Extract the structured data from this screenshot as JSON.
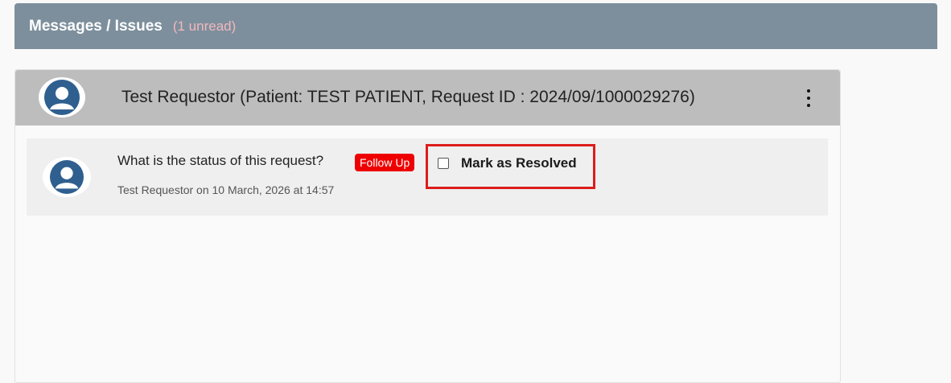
{
  "header": {
    "title": "Messages / Issues",
    "unread": "(1 unread)"
  },
  "thread": {
    "title": "Test Requestor (Patient: TEST PATIENT, Request ID : 2024/09/1000029276)",
    "avatar_icon": "user-avatar-icon",
    "menu_icon": "kebab-menu-icon"
  },
  "message": {
    "text": "What is the status of this request?",
    "badge": "Follow Up",
    "meta": "Test Requestor on 10 March, 2026 at 14:57",
    "resolve_label": "Mark as Resolved",
    "resolved": false,
    "avatar_icon": "user-avatar-icon"
  },
  "colors": {
    "header_bg": "#7d8f9d",
    "unread_text": "#f3b7bd",
    "thread_header_bg": "#bdbdbd",
    "avatar_blue": "#2f5f8f",
    "badge_red": "#ee0000",
    "highlight_red": "#dd1c1c"
  }
}
